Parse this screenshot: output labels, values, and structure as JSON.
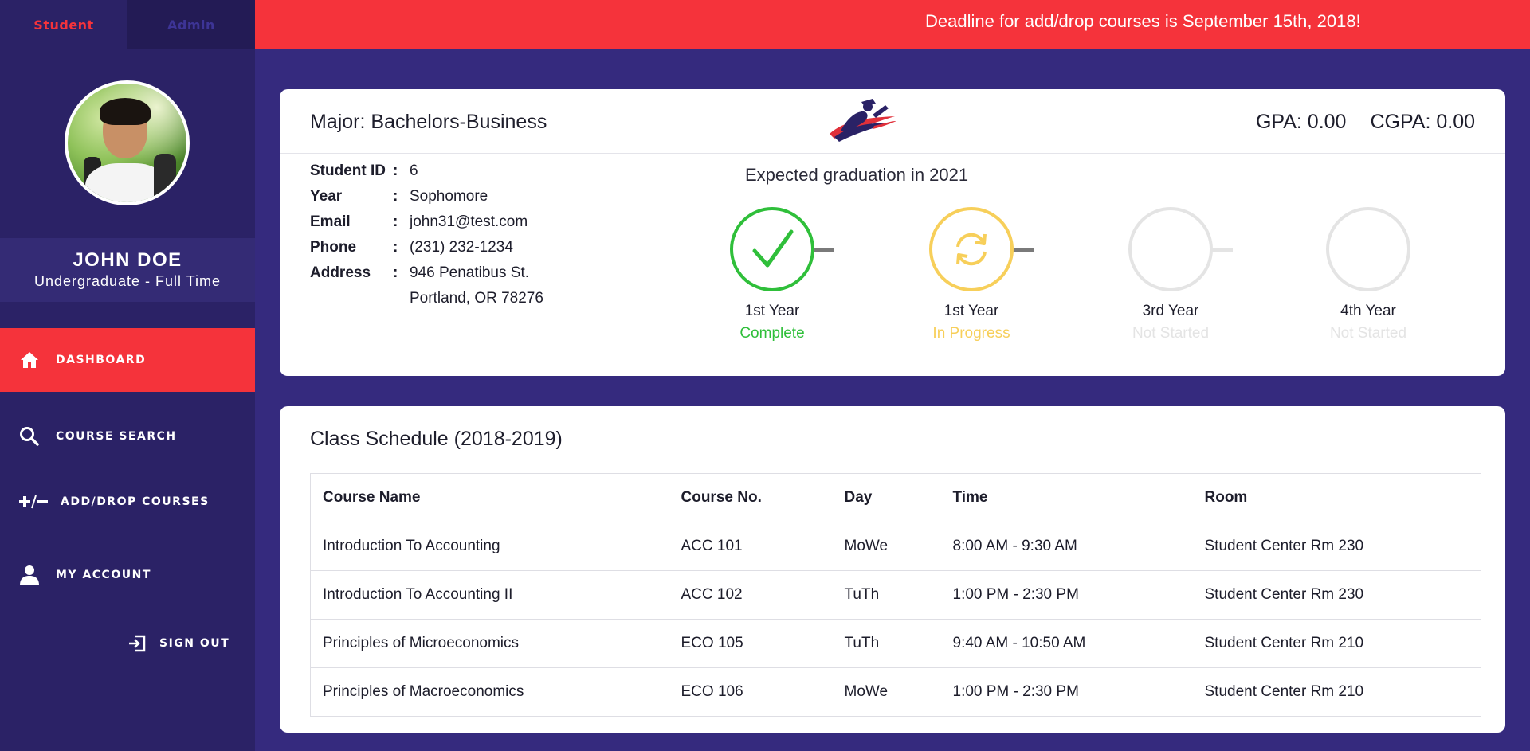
{
  "sidebar": {
    "role_tabs": [
      {
        "label": "Student",
        "active": true
      },
      {
        "label": "Admin",
        "active": false
      }
    ],
    "student_name": "JOHN DOE",
    "student_status": "Undergraduate - Full Time",
    "nav": [
      {
        "label": "DASHBOARD",
        "icon": "home-icon",
        "active": true
      },
      {
        "label": "COURSE SEARCH",
        "icon": "search-icon",
        "active": false
      },
      {
        "label": "ADD/DROP COURSES",
        "icon": "plus-minus-icon",
        "active": false
      },
      {
        "label": "MY ACCOUNT",
        "icon": "user-icon",
        "active": false
      }
    ],
    "signout_label": "SIGN OUT"
  },
  "banner": {
    "text": "Deadline for add/drop courses is September 15th, 2018!"
  },
  "profile": {
    "major": "Major: Bachelors-Business",
    "gpa": "GPA: 0.00",
    "cgpa": "CGPA: 0.00",
    "fields": [
      {
        "label": "Student ID",
        "value": "6"
      },
      {
        "label": "Year",
        "value": "Sophomore"
      },
      {
        "label": "Email",
        "value": "john31@test.com"
      },
      {
        "label": "Phone",
        "value": "(231) 232-1234"
      },
      {
        "label": "Address",
        "value": "946 Penatibus St."
      },
      {
        "label": "",
        "value": "Portland, OR 78276"
      }
    ],
    "colon": ":",
    "expected_graduation": "Expected graduation in 2021",
    "steps": [
      {
        "title": "1st Year",
        "status": "Complete",
        "state": "complete",
        "icon": "checkmark-icon"
      },
      {
        "title": "1st Year",
        "status": "In Progress",
        "state": "in-progress",
        "icon": "refresh-icon"
      },
      {
        "title": "3rd Year",
        "status": "Not Started",
        "state": "not-started",
        "icon": ""
      },
      {
        "title": "4th Year",
        "status": "Not Started",
        "state": "not-started",
        "icon": ""
      }
    ]
  },
  "schedule": {
    "title": "Class Schedule (2018-2019)",
    "columns": [
      "Course Name",
      "Course No.",
      "Day",
      "Time",
      "Room"
    ],
    "rows": [
      [
        "Introduction To Accounting",
        "ACC 101",
        "MoWe",
        "8:00 AM - 9:30 AM",
        "Student Center Rm 230"
      ],
      [
        "Introduction To Accounting II",
        "ACC 102",
        "TuTh",
        "1:00 PM - 2:30 PM",
        "Student Center Rm 230"
      ],
      [
        "Principles of Microeconomics",
        "ECO 105",
        "TuTh",
        "9:40 AM - 10:50 AM",
        "Student Center Rm 210"
      ],
      [
        "Principles of Macroeconomics",
        "ECO 106",
        "MoWe",
        "1:00 PM - 2:30 PM",
        "Student Center Rm 210"
      ]
    ]
  },
  "colors": {
    "accent_red": "#f5333b",
    "sidebar_bg": "#2b2266",
    "page_bg": "#352a7e",
    "complete_green": "#2fbf3a",
    "progress_yellow": "#f7cf5a",
    "not_started_gray": "#e4e4e4"
  }
}
